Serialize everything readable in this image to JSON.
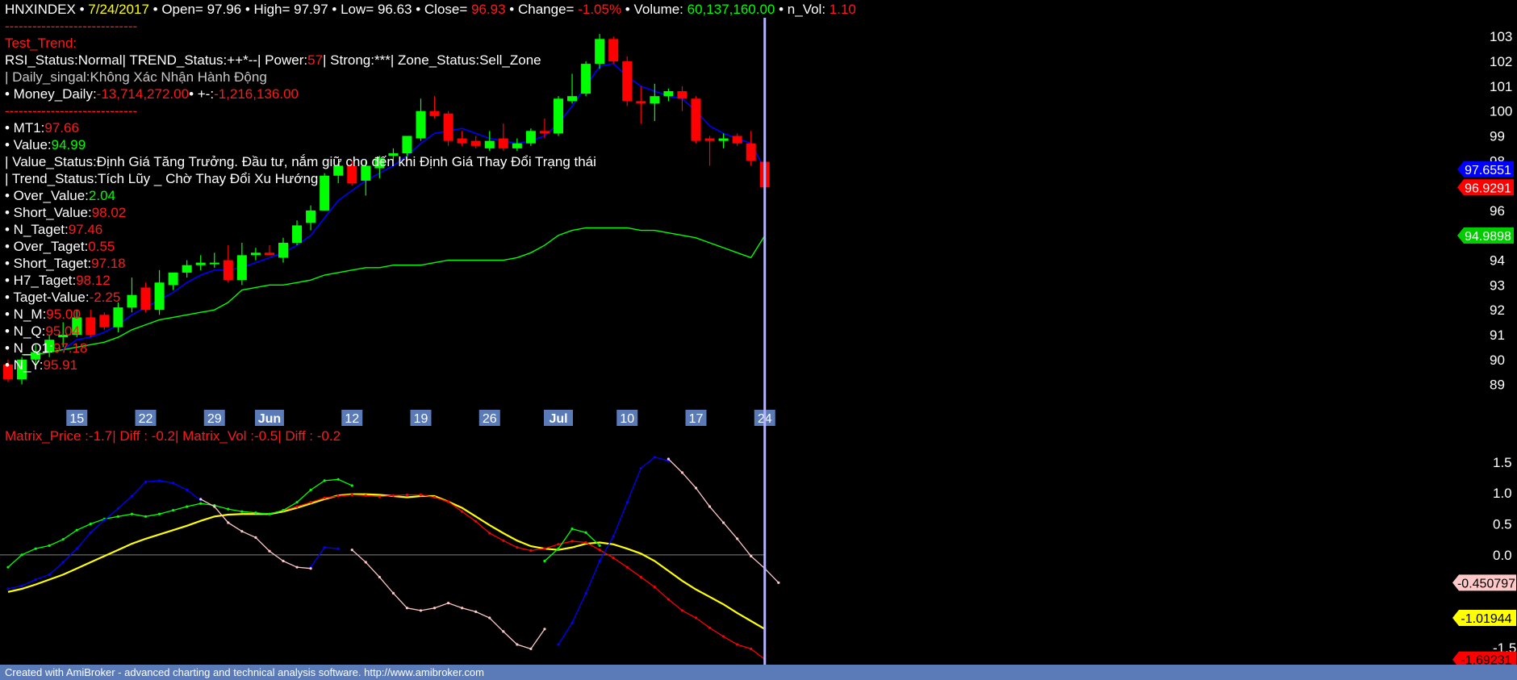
{
  "header": {
    "symbol": "HNXINDEX",
    "sep": " • ",
    "date": "7/24/2017",
    "open_label": "Open=",
    "open": "97.96",
    "high_label": "High=",
    "high": "97.97",
    "low_label": "Low=",
    "low": "96.63",
    "close_label": "Close=",
    "close": "96.93",
    "change_label": "Change=",
    "change": "-1.05%",
    "volume_label": "Volume:",
    "volume": "60,137,160.00",
    "nvol_label": "n_Vol:",
    "nvol": "1.10"
  },
  "info": {
    "dashes": "-----------------------------",
    "test_trend": "Test_Trend:",
    "rsi_status": "RSI_Status:Normal| TREND_Status:++*--| Power:",
    "power": "57",
    "strong": "| Strong:***| Zone_Status:Sell_Zone",
    "daily_signal": "| Daily_singal:Không Xác Nhận Hành Động",
    "money_daily_label": "• Money_Daily:",
    "money_daily": "-13,714,272.00",
    "pm_label": "• +-:",
    "pm": "-1,216,136.00",
    "mt1_label": "• MT1:",
    "mt1": "97.66",
    "value_label": "• Value:",
    "value": "94.99",
    "value_status": "| Value_Status:Định Giá Tăng Trưởng. Đầu tư, nắm giữ cho đến khi Định Giá Thay Đổi Trạng thái",
    "trend_status": "| Trend_Status:Tích Lũy _ Chờ Thay Đổi Xu Hướng",
    "over_value_label": "• Over_Value:",
    "over_value": "2.04",
    "short_value_label": "• Short_Value:",
    "short_value": "98.02",
    "n_taget_label": "• N_Taget:",
    "n_taget": "97.46",
    "over_taget_label": "• Over_Taget:",
    "over_taget": "0.55",
    "short_taget_label": "• Short_Taget:",
    "short_taget": "97.18",
    "h7_taget_label": "• H7_Taget:",
    "h7_taget": "98.12",
    "taget_value_label": "• Taget-Value:",
    "taget_value": "-2.25",
    "n_m_label": "• N_M:",
    "n_m": "95.00",
    "n_q_label": "• N_Q:",
    "n_q": "95.04",
    "n_q1_label": "• N_Q1:",
    "n_q1": "97.18",
    "n_y_label": "• N_Y:",
    "n_y": "95.91"
  },
  "matrix_title": "Matrix_Price :-1.7|    Diff : -0.2| Matrix_Vol :-0.5|     Diff : -0.2",
  "footer": "Created with AmiBroker - advanced charting and technical analysis software. http://www.amibroker.com",
  "colors": {
    "up": "#00ff00",
    "down": "#ff0000",
    "ma": "#0000ff",
    "value_line": "#00ff00",
    "cursor": "#b4b4ff",
    "axis_tag_bg": "#5b7ab8",
    "mt1_tag": "#0000ff",
    "close_tag": "#ff0000",
    "value_tag": "#00cc00"
  },
  "chart_data": [
    {
      "type": "candlestick",
      "ylim": [
        88.5,
        103.3
      ],
      "y_ticks": [
        "89",
        "90",
        "91",
        "92",
        "93",
        "94",
        "95",
        "96",
        "97",
        "98",
        "99",
        "100",
        "101",
        "102",
        "103"
      ],
      "x_tick_labels": [
        "15",
        "22",
        "29",
        "Jun",
        "12",
        "19",
        "26",
        "Jul",
        "10",
        "17",
        "24"
      ],
      "x_tick_index": [
        5,
        10,
        15,
        19,
        25,
        30,
        35,
        40,
        45,
        50,
        55
      ],
      "bold_ticks": [
        "Jun",
        "Jul"
      ],
      "candles": [
        {
          "o": 89.8,
          "h": 90.0,
          "l": 89.1,
          "c": 89.2
        },
        {
          "o": 89.2,
          "h": 90.1,
          "l": 89.0,
          "c": 90.0
        },
        {
          "o": 90.0,
          "h": 90.6,
          "l": 89.8,
          "c": 90.3
        },
        {
          "o": 90.3,
          "h": 91.0,
          "l": 90.1,
          "c": 90.8
        },
        {
          "o": 90.9,
          "h": 91.5,
          "l": 90.5,
          "c": 91.0
        },
        {
          "o": 91.0,
          "h": 92.0,
          "l": 90.9,
          "c": 91.7
        },
        {
          "o": 91.7,
          "h": 92.0,
          "l": 90.9,
          "c": 91.0
        },
        {
          "o": 91.8,
          "h": 91.9,
          "l": 91.2,
          "c": 91.3
        },
        {
          "o": 91.3,
          "h": 92.3,
          "l": 91.1,
          "c": 92.1
        },
        {
          "o": 92.1,
          "h": 93.3,
          "l": 91.9,
          "c": 92.6
        },
        {
          "o": 92.9,
          "h": 93.1,
          "l": 91.9,
          "c": 92.0
        },
        {
          "o": 92.0,
          "h": 93.6,
          "l": 91.8,
          "c": 93.1
        },
        {
          "o": 93.0,
          "h": 93.4,
          "l": 92.8,
          "c": 93.5
        },
        {
          "o": 93.5,
          "h": 94.0,
          "l": 93.3,
          "c": 93.8
        },
        {
          "o": 93.8,
          "h": 94.2,
          "l": 93.6,
          "c": 93.9
        },
        {
          "o": 93.9,
          "h": 94.3,
          "l": 93.7,
          "c": 93.9
        },
        {
          "o": 94.0,
          "h": 94.6,
          "l": 93.1,
          "c": 93.2
        },
        {
          "o": 93.2,
          "h": 94.7,
          "l": 93.0,
          "c": 94.2
        },
        {
          "o": 94.2,
          "h": 94.5,
          "l": 94.0,
          "c": 94.3
        },
        {
          "o": 94.3,
          "h": 94.6,
          "l": 94.2,
          "c": 94.2
        },
        {
          "o": 94.1,
          "h": 94.9,
          "l": 93.9,
          "c": 94.7
        },
        {
          "o": 94.7,
          "h": 95.6,
          "l": 94.6,
          "c": 95.4
        },
        {
          "o": 95.5,
          "h": 96.2,
          "l": 95.2,
          "c": 96.0
        },
        {
          "o": 96.0,
          "h": 97.5,
          "l": 96.0,
          "c": 97.4
        },
        {
          "o": 97.4,
          "h": 97.9,
          "l": 97.1,
          "c": 97.8
        },
        {
          "o": 97.8,
          "h": 98.0,
          "l": 97.0,
          "c": 97.1
        },
        {
          "o": 97.2,
          "h": 98.0,
          "l": 96.6,
          "c": 97.8
        },
        {
          "o": 97.7,
          "h": 98.2,
          "l": 97.3,
          "c": 98.1
        },
        {
          "o": 98.2,
          "h": 98.5,
          "l": 98.0,
          "c": 98.3
        },
        {
          "o": 98.3,
          "h": 98.9,
          "l": 98.2,
          "c": 99.0
        },
        {
          "o": 98.9,
          "h": 100.5,
          "l": 98.8,
          "c": 100.0
        },
        {
          "o": 100.0,
          "h": 100.6,
          "l": 99.7,
          "c": 99.8
        },
        {
          "o": 99.9,
          "h": 100.0,
          "l": 98.6,
          "c": 98.8
        },
        {
          "o": 98.9,
          "h": 99.2,
          "l": 98.6,
          "c": 98.7
        },
        {
          "o": 98.8,
          "h": 99.0,
          "l": 98.5,
          "c": 98.6
        },
        {
          "o": 98.5,
          "h": 99.2,
          "l": 98.4,
          "c": 98.8
        },
        {
          "o": 98.9,
          "h": 99.5,
          "l": 98.4,
          "c": 98.5
        },
        {
          "o": 98.5,
          "h": 98.9,
          "l": 98.4,
          "c": 98.7
        },
        {
          "o": 98.7,
          "h": 99.3,
          "l": 98.6,
          "c": 99.2
        },
        {
          "o": 99.2,
          "h": 99.7,
          "l": 98.9,
          "c": 99.1
        },
        {
          "o": 99.1,
          "h": 100.6,
          "l": 99.0,
          "c": 100.5
        },
        {
          "o": 100.4,
          "h": 101.5,
          "l": 100.3,
          "c": 100.6
        },
        {
          "o": 100.7,
          "h": 102.0,
          "l": 100.6,
          "c": 101.9
        },
        {
          "o": 101.9,
          "h": 103.1,
          "l": 101.7,
          "c": 102.9
        },
        {
          "o": 102.9,
          "h": 103.0,
          "l": 101.9,
          "c": 102.0
        },
        {
          "o": 102.0,
          "h": 102.2,
          "l": 100.2,
          "c": 100.4
        },
        {
          "o": 100.4,
          "h": 101.0,
          "l": 99.5,
          "c": 100.3
        },
        {
          "o": 100.3,
          "h": 101.1,
          "l": 99.6,
          "c": 100.6
        },
        {
          "o": 100.6,
          "h": 100.9,
          "l": 100.4,
          "c": 100.8
        },
        {
          "o": 100.8,
          "h": 101.0,
          "l": 100.0,
          "c": 100.5
        },
        {
          "o": 100.5,
          "h": 100.6,
          "l": 98.7,
          "c": 98.8
        },
        {
          "o": 98.9,
          "h": 99.0,
          "l": 97.8,
          "c": 98.8
        },
        {
          "o": 98.8,
          "h": 99.1,
          "l": 98.5,
          "c": 98.9
        },
        {
          "o": 99.0,
          "h": 99.1,
          "l": 98.6,
          "c": 98.7
        },
        {
          "o": 98.7,
          "h": 99.2,
          "l": 97.8,
          "c": 98.0
        },
        {
          "o": 97.96,
          "h": 97.97,
          "l": 96.63,
          "c": 96.93
        }
      ],
      "ma_line": {
        "name": "MT1",
        "values": [
          null,
          null,
          null,
          null,
          90.4,
          90.8,
          90.9,
          91.1,
          91.4,
          91.8,
          92.1,
          92.4,
          92.7,
          93.1,
          93.4,
          93.6,
          93.6,
          93.7,
          93.9,
          94.1,
          94.3,
          94.6,
          95.0,
          95.7,
          96.4,
          96.8,
          97.2,
          97.5,
          97.8,
          98.2,
          98.7,
          99.1,
          99.2,
          99.3,
          99.1,
          98.9,
          98.8,
          98.7,
          98.8,
          99.0,
          99.5,
          100.2,
          101.0,
          101.8,
          101.9,
          101.4,
          101.0,
          100.8,
          100.6,
          100.5,
          100.0,
          99.4,
          99.1,
          98.9,
          98.7,
          97.66
        ]
      },
      "value_line": {
        "name": "Value",
        "values": [
          null,
          90.2,
          90.2,
          90.3,
          90.4,
          90.5,
          90.6,
          90.7,
          90.9,
          91.2,
          91.4,
          91.6,
          91.7,
          91.8,
          91.9,
          92.0,
          92.3,
          92.8,
          92.9,
          93.0,
          93.0,
          93.1,
          93.2,
          93.4,
          93.5,
          93.6,
          93.7,
          93.7,
          93.8,
          93.8,
          93.8,
          93.9,
          94.0,
          94.0,
          94.0,
          94.0,
          94.0,
          94.1,
          94.3,
          94.6,
          95.0,
          95.2,
          95.3,
          95.3,
          95.3,
          95.3,
          95.2,
          95.2,
          95.1,
          95.0,
          94.9,
          94.7,
          94.5,
          94.3,
          94.1,
          94.99
        ]
      },
      "tags": [
        {
          "label": "97.6551",
          "value": 97.6551
        },
        {
          "label": "96.9291",
          "value": 96.9291
        },
        {
          "label": "94.9898",
          "value": 94.9898
        }
      ]
    },
    {
      "type": "line",
      "ylim": [
        -1.75,
        1.85
      ],
      "y_ticks": [
        "1.5",
        "1.0",
        "0.5",
        "0.0",
        "-1.5"
      ],
      "zero_line": 0,
      "series": [
        {
          "color": "#ffff00",
          "dotted": false,
          "values": [
            -0.6,
            -0.55,
            -0.48,
            -0.4,
            -0.32,
            -0.22,
            -0.12,
            -0.02,
            0.08,
            0.18,
            0.26,
            0.33,
            0.4,
            0.47,
            0.55,
            0.62,
            0.65,
            0.66,
            0.66,
            0.66,
            0.7,
            0.76,
            0.83,
            0.9,
            0.96,
            0.98,
            0.98,
            0.97,
            0.95,
            0.93,
            0.95,
            0.95,
            0.86,
            0.76,
            0.62,
            0.48,
            0.35,
            0.23,
            0.14,
            0.1,
            0.08,
            0.12,
            0.18,
            0.2,
            0.17,
            0.1,
            0.02,
            -0.1,
            -0.26,
            -0.42,
            -0.56,
            -0.68,
            -0.8,
            -0.94,
            -1.07,
            -1.2
          ]
        },
        {
          "color": "#ff0000",
          "dotted": true,
          "values": [
            null,
            null,
            null,
            null,
            null,
            null,
            null,
            null,
            null,
            null,
            null,
            null,
            null,
            null,
            null,
            null,
            null,
            null,
            null,
            null,
            0.72,
            0.78,
            0.85,
            0.92,
            0.95,
            0.97,
            0.96,
            0.94,
            0.96,
            0.97,
            0.97,
            0.93,
            0.86,
            0.7,
            0.54,
            0.35,
            0.23,
            0.12,
            0.07,
            0.1,
            0.17,
            0.22,
            0.2,
            0.08,
            -0.05,
            -0.2,
            -0.36,
            -0.52,
            -0.72,
            -0.9,
            -1.02,
            -1.18,
            -1.32,
            -1.45,
            -1.52,
            -1.69
          ]
        },
        {
          "color": "#00ff00",
          "dotted": true,
          "values": [
            -0.2,
            0.0,
            0.1,
            0.15,
            0.25,
            0.4,
            0.5,
            0.58,
            0.62,
            0.66,
            0.62,
            0.66,
            0.72,
            0.78,
            0.83,
            0.8,
            0.74,
            0.7,
            0.68,
            0.66,
            0.72,
            0.85,
            1.05,
            1.2,
            1.22,
            1.12,
            null,
            null,
            null,
            null,
            null,
            null,
            null,
            null,
            null,
            null,
            null,
            null,
            null,
            -0.1,
            0.1,
            0.42,
            0.36,
            0.15,
            null,
            null,
            null,
            null,
            null,
            null,
            null,
            null,
            null,
            null,
            null,
            null
          ]
        },
        {
          "color": "#0000ff",
          "dotted": true,
          "values": [
            -0.55,
            -0.5,
            -0.4,
            -0.32,
            -0.12,
            0.1,
            0.36,
            0.56,
            0.75,
            0.95,
            1.18,
            1.2,
            1.16,
            1.05,
            0.88,
            null,
            null,
            null,
            null,
            null,
            null,
            null,
            -0.2,
            0.12,
            0.1,
            null,
            null,
            null,
            null,
            null,
            null,
            null,
            null,
            null,
            null,
            null,
            null,
            null,
            null,
            null,
            -1.45,
            -1.1,
            -0.62,
            -0.1,
            0.3,
            0.85,
            1.4,
            1.58,
            1.52,
            null,
            null,
            null,
            null,
            null,
            null,
            null
          ]
        },
        {
          "color": "#ffc8c8",
          "dotted": true,
          "values": [
            null,
            null,
            null,
            null,
            null,
            null,
            null,
            null,
            null,
            null,
            null,
            null,
            null,
            null,
            0.9,
            0.78,
            0.52,
            0.38,
            0.28,
            0.06,
            -0.1,
            -0.2,
            -0.22,
            null,
            null,
            0.08,
            -0.12,
            -0.36,
            -0.62,
            -0.86,
            -0.9,
            -0.86,
            -0.78,
            -0.86,
            -0.92,
            -1.02,
            -1.24,
            -1.45,
            -1.52,
            -1.2,
            null,
            null,
            null,
            null,
            null,
            null,
            null,
            null,
            1.55,
            1.33,
            1.08,
            0.78,
            0.52,
            0.26,
            -0.02,
            -0.22,
            -0.45
          ]
        }
      ],
      "tags": [
        {
          "label": "-0.450797",
          "value": -0.450797,
          "color": "#ffc8c8"
        },
        {
          "label": "-1.01944",
          "value": -1.01944,
          "color": "#ffff00"
        },
        {
          "label": "-1.69231",
          "value": -1.69231,
          "color": "#ff0000"
        }
      ]
    }
  ]
}
